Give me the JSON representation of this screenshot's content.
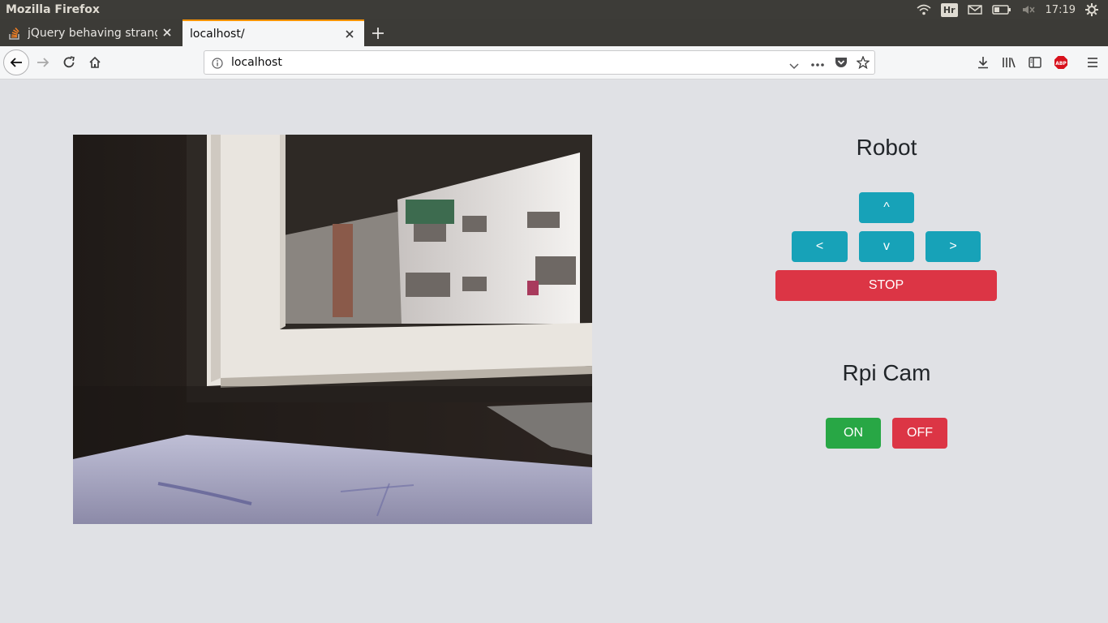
{
  "os": {
    "window_title": "Mozilla Firefox",
    "keyboard_layout": "Hr",
    "clock": "17:19"
  },
  "browser": {
    "tabs": [
      {
        "label": "jQuery behaving strange",
        "active": false,
        "icon": "stackoverflow-icon"
      },
      {
        "label": "localhost/",
        "active": true
      }
    ],
    "url": "localhost"
  },
  "page": {
    "robot": {
      "title": "Robot",
      "up_label": "^",
      "left_label": "<",
      "down_label": "v",
      "right_label": ">",
      "stop_label": "STOP"
    },
    "cam": {
      "title": "Rpi Cam",
      "on_label": "ON",
      "off_label": "OFF"
    }
  },
  "colors": {
    "info": "#17a2b8",
    "danger": "#dc3545",
    "success": "#28a745",
    "tab_accent": "#ff9400"
  }
}
